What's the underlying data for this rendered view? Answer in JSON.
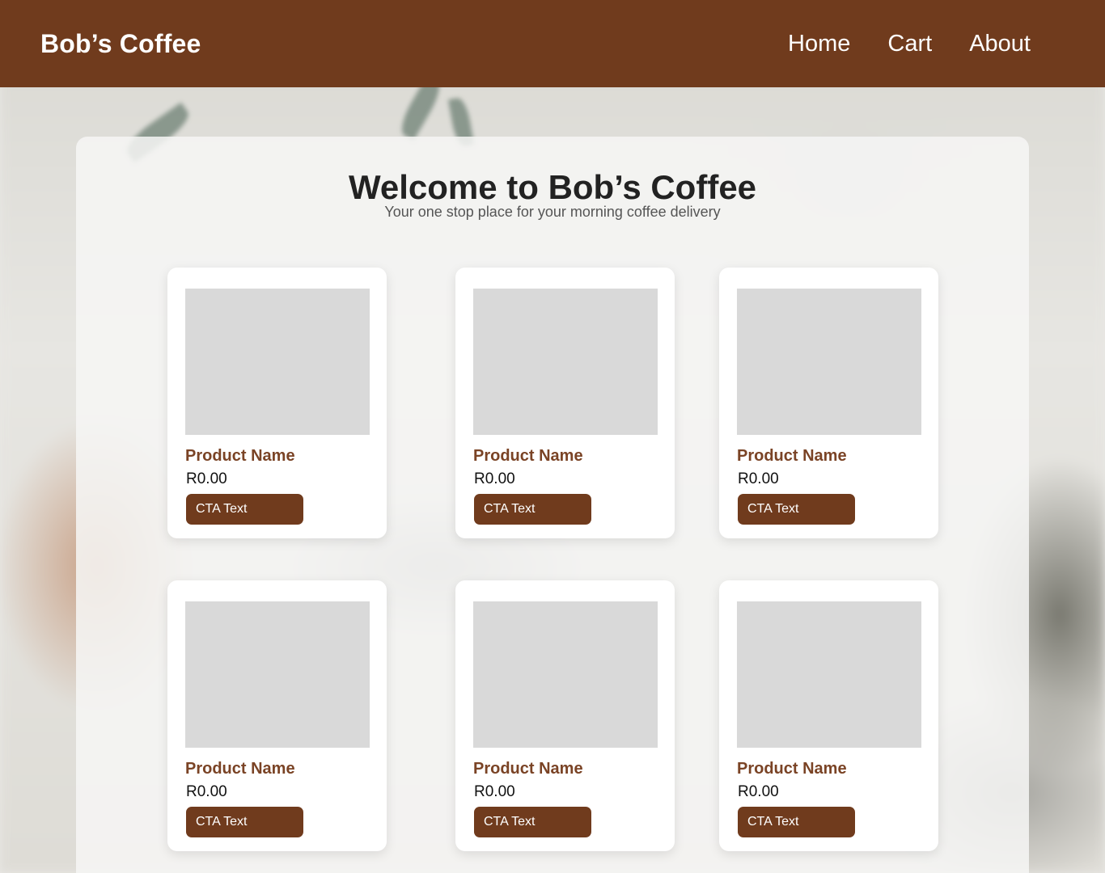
{
  "header": {
    "brand": "Bob’s Coffee",
    "nav": [
      "Home",
      "Cart",
      "About"
    ]
  },
  "hero": {
    "title": "Welcome to Bob’s Coffee",
    "subtitle": "Your one stop place for your morning coffee delivery"
  },
  "products": [
    {
      "name": "Product Name",
      "price": "R0.00",
      "cta": "CTA Text"
    },
    {
      "name": "Product Name",
      "price": "R0.00",
      "cta": "CTA Text"
    },
    {
      "name": "Product Name",
      "price": "R0.00",
      "cta": "CTA Text"
    },
    {
      "name": "Product Name",
      "price": "R0.00",
      "cta": "CTA Text"
    },
    {
      "name": "Product Name",
      "price": "R0.00",
      "cta": "CTA Text"
    },
    {
      "name": "Product Name",
      "price": "R0.00",
      "cta": "CTA Text"
    }
  ],
  "colors": {
    "brand_brown": "#703b1d",
    "product_name": "#7a4325",
    "image_placeholder": "#d9d9d9"
  }
}
